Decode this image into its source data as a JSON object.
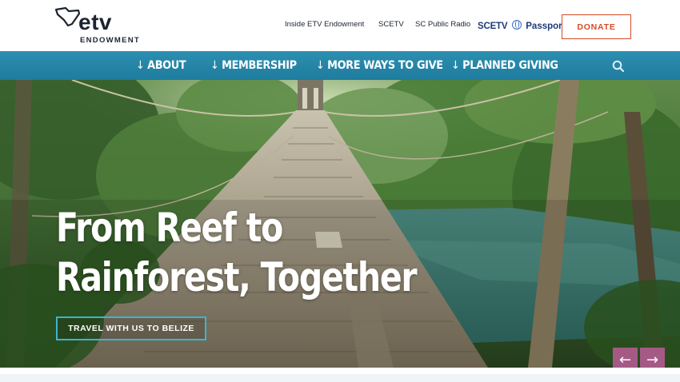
{
  "header": {
    "logo": {
      "wordmark": "etv",
      "subtitle": "ENDOWMENT"
    },
    "utility_links": [
      "Inside ETV Endowment",
      "SCETV",
      "SC Public Radio"
    ],
    "passport": {
      "prefix": "SCETV",
      "word": "Passport"
    },
    "donate_label": "DONATE"
  },
  "nav": {
    "arrow": "↓",
    "items": [
      "ABOUT",
      "MEMBERSHIP",
      "MORE WAYS TO GIVE",
      "PLANNED GIVING"
    ],
    "search_icon": "search-icon"
  },
  "hero": {
    "title_lines": [
      "From Reef to",
      "Rainforest, Together"
    ],
    "cta_label": "TRAVEL WITH US TO BELIZE",
    "prev_glyph": "←",
    "next_glyph": "→"
  },
  "colors": {
    "nav_bg": "#2386a8",
    "donate": "#d64b27",
    "cta_border": "#3fb3cf",
    "slider_button": "#a55a86",
    "passport_text": "#1f3a7a"
  }
}
